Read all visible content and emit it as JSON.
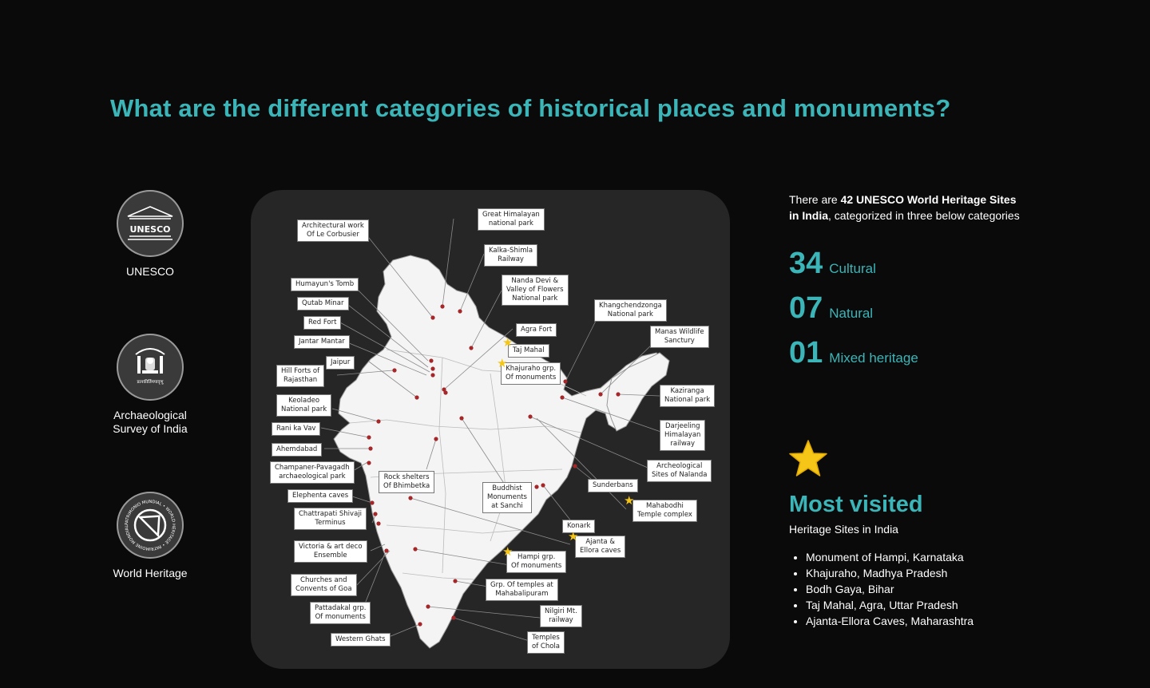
{
  "heading": "What are the different categories of historical places and monuments?",
  "organizations": [
    {
      "name": "UNESCO",
      "icon": "unesco-temple-icon",
      "emblem_text": "UNESCO"
    },
    {
      "name": "Archaeological Survey of India",
      "icon": "asi-emblem-icon",
      "emblem_text": "प्रत्नकीर्तिमपावृणु"
    },
    {
      "name": "World Heritage",
      "icon": "world-heritage-icon",
      "emblem_text": "PATRIMONIO MUNDIAL • WORLD HERITAGE • PATRIMOINE MONDIAL"
    }
  ],
  "map": {
    "site_labels": [
      "Architectural work\nOf Le Corbusier",
      "Great Himalayan\nnational park",
      "Kalka-Shimla\nRailway",
      "Nanda Devi &\nValley of Flowers\nNational park",
      "Humayun's Tomb",
      "Qutab Minar",
      "Red Fort",
      "Jantar Mantar",
      "Agra Fort",
      "Taj Mahal",
      "Khajuraho grp.\nOf monuments",
      "Jaipur",
      "Hill Forts of\nRajasthan",
      "Keoladeo\nNational park",
      "Rani ka Vav",
      "Ahemdabad",
      "Champaner-Pavagadh\narchaeological park",
      "Rock shelters\nOf Bhimbetka",
      "Buddhist\nMonuments\nat Sanchi",
      "Elephenta caves",
      "Chattrapati Shivaji\nTerminus",
      "Victoria & art deco\nEnsemble",
      "Churches and\nConvents of Goa",
      "Pattadakal grp.\nOf monuments",
      "Western Ghats",
      "Khangchendzonga\nNational park",
      "Manas Wildlife\nSanctury",
      "Kaziranga\nNational park",
      "Darjeeling\nHimalayan\nrailway",
      "Archeological\nSites of Nalanda",
      "Sunderbans",
      "Mahabodhi\nTemple complex",
      "Konark",
      "Ajanta &\nEllora caves",
      "Hampi grp.\nOf monuments",
      "Grp. Of temples at\nMahabalipuram",
      "Nilgiri Mt.\nrailway",
      "Temples\nof Chola"
    ],
    "starred_sites": [
      "Taj Mahal",
      "Khajuraho grp. Of monuments",
      "Mahabodhi Temple complex",
      "Ajanta & Ellora caves",
      "Hampi grp. Of monuments"
    ]
  },
  "summary": {
    "prefix": "There are ",
    "bold": "42 UNESCO World Heritage Sites in India",
    "suffix": ", categorized in three below categories"
  },
  "categories": [
    {
      "count": "34",
      "label": "Cultural"
    },
    {
      "count": "07",
      "label": "Natural"
    },
    {
      "count": "01",
      "label": "Mixed heritage"
    }
  ],
  "most_visited": {
    "icon": "star-icon",
    "title": "Most visited",
    "subtitle": "Heritage Sites in India",
    "items": [
      "Monument of Hampi, Karnataka",
      "Khajuraho, Madhya Pradesh",
      "Bodh Gaya, Bihar",
      "Taj Mahal, Agra, Uttar Pradesh",
      "Ajanta-Ellora Caves, Maharashtra"
    ]
  },
  "colors": {
    "accent": "#3bb5b8",
    "background": "#0a0a0a",
    "card": "#262626",
    "star": "#f5c518",
    "marker": "#a3282c"
  }
}
